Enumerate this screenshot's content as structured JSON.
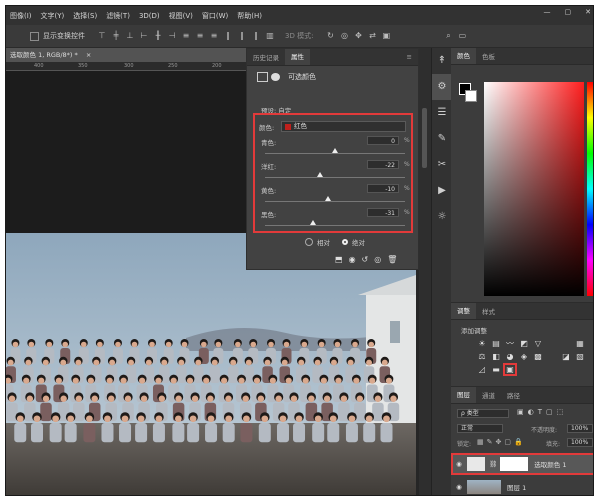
{
  "menu": [
    "图像(I)",
    "文字(Y)",
    "选择(S)",
    "滤镜(T)",
    "3D(D)",
    "视图(V)",
    "窗口(W)",
    "帮助(H)"
  ],
  "window_controls": [
    "—",
    "▢",
    "✕"
  ],
  "options_bar": {
    "show_transform": "显示变换控件",
    "mode_3d": "3D 模式:"
  },
  "doc_tab": "选取颜色 1, RGB/8*) *",
  "ruler_marks": [
    "400",
    "350",
    "300",
    "250",
    "200"
  ],
  "properties": {
    "tabs": [
      "历史记录",
      "属性"
    ],
    "title": "可选颜色",
    "preset": "预设: 自定",
    "color_label": "颜色:",
    "color_value": "红色",
    "sliders": [
      {
        "label": "青色:",
        "value": "0",
        "fraction": 0.5
      },
      {
        "label": "洋红:",
        "value": "-22",
        "fraction": 0.39
      },
      {
        "label": "黄色:",
        "value": "-10",
        "fraction": 0.45
      },
      {
        "label": "黑色:",
        "value": "-31",
        "fraction": 0.345
      }
    ],
    "percent": "%",
    "method_relative": "相对",
    "method_absolute": "绝对"
  },
  "color_panel": {
    "tabs": [
      "颜色",
      "色板"
    ]
  },
  "adjustments": {
    "tabs": [
      "调整",
      "样式"
    ],
    "add_label": "添加调整"
  },
  "layers": {
    "tabs": [
      "图层",
      "通道",
      "路径"
    ],
    "kind": "ρ 类型",
    "blend": "正常",
    "opacity_label": "不透明度:",
    "opacity": "100%",
    "lock_label": "锁定:",
    "fill_label": "填充:",
    "fill": "100%",
    "rows": [
      {
        "name": "选取颜色 1"
      },
      {
        "name": "图层 1"
      }
    ]
  },
  "colors": {
    "accent_red": "#e23a3a",
    "swatch_red": "#c0201c"
  }
}
